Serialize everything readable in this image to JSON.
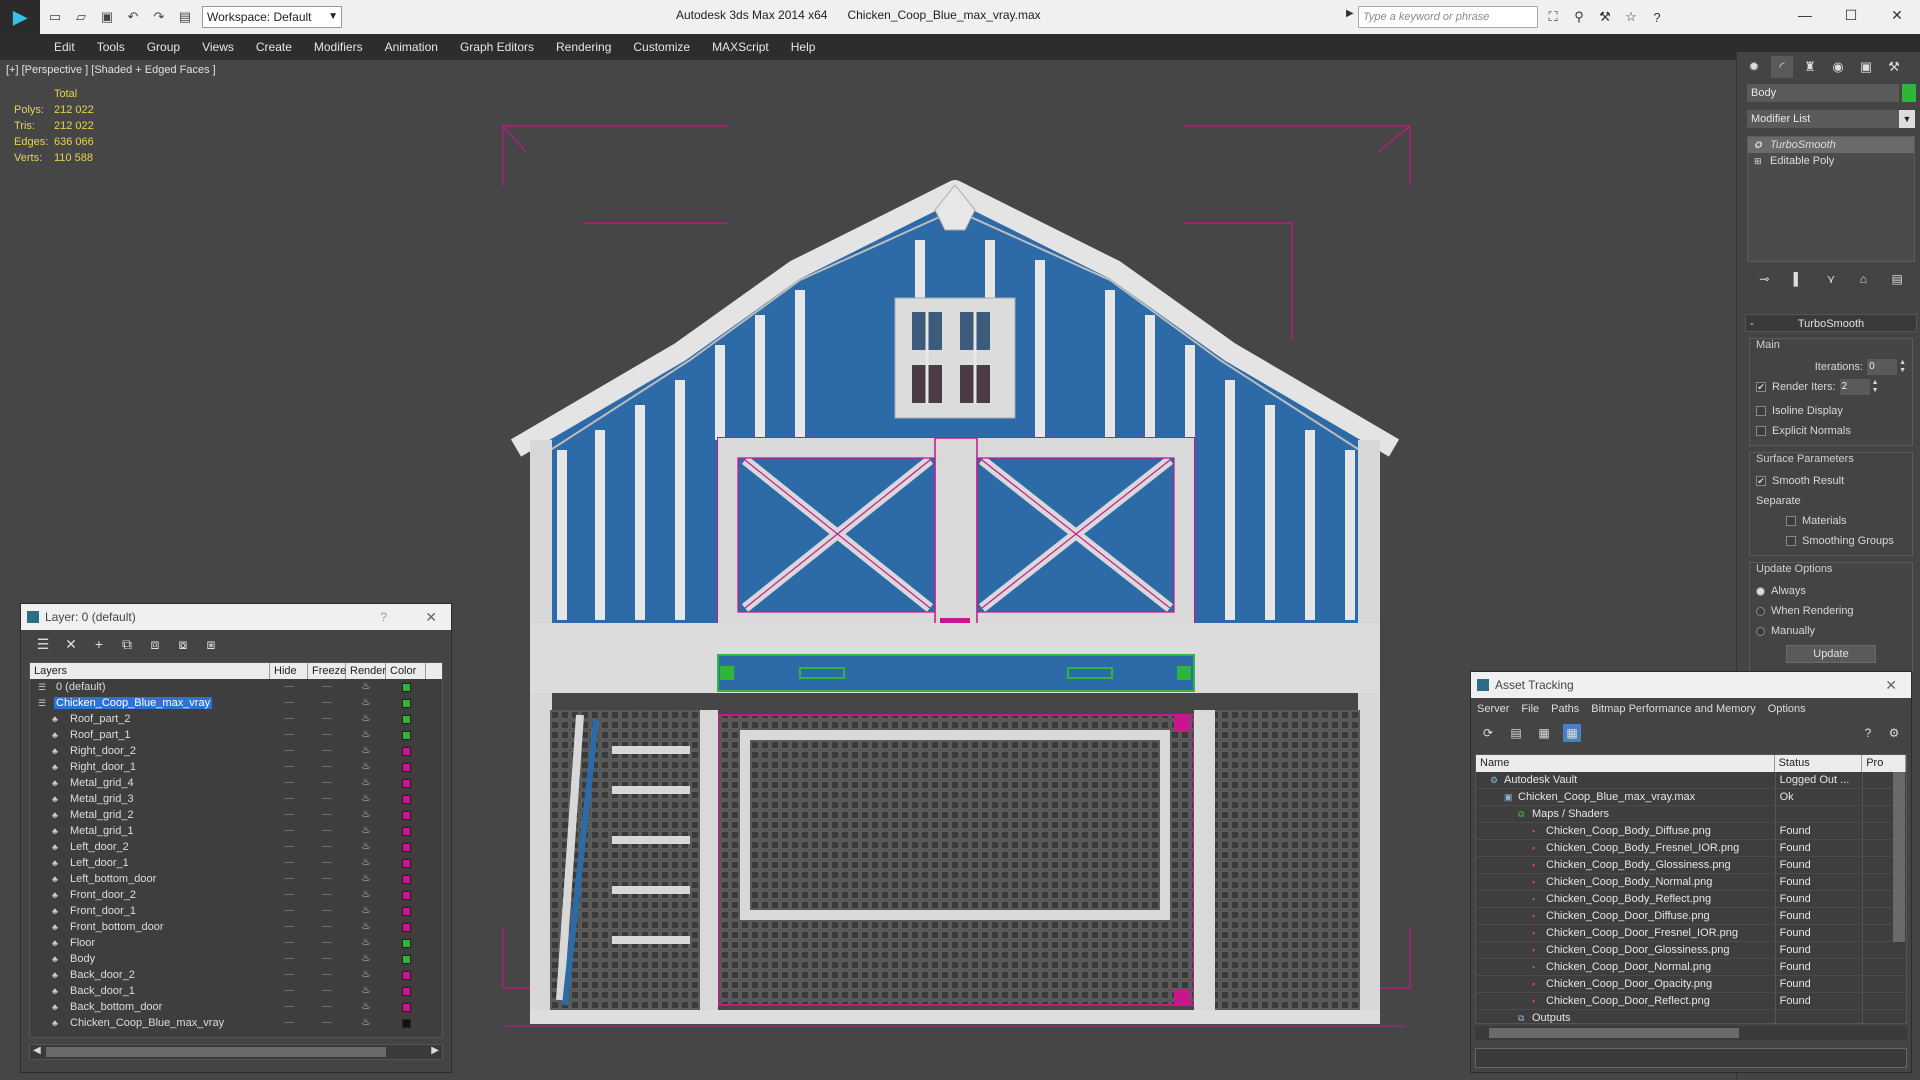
{
  "titlebar": {
    "app_title": "Autodesk 3ds Max 2014 x64",
    "file_name": "Chicken_Coop_Blue_max_vray.max",
    "workspace_label": "Workspace: Default",
    "search_placeholder": "Type a keyword or phrase"
  },
  "menu": [
    "Edit",
    "Tools",
    "Group",
    "Views",
    "Create",
    "Modifiers",
    "Animation",
    "Graph Editors",
    "Rendering",
    "Customize",
    "MAXScript",
    "Help"
  ],
  "viewport": {
    "label": "[+] [Perspective ] [Shaded + Edged Faces ]",
    "stats": {
      "header": "Total",
      "polys_label": "Polys:",
      "polys": "212 022",
      "tris_label": "Tris:",
      "tris": "212 022",
      "edges_label": "Edges:",
      "edges": "636 066",
      "verts_label": "Verts:",
      "verts": "110 588"
    }
  },
  "command_panel": {
    "object_name": "Body",
    "object_color": "#2fb63a",
    "modifier_list": "Modifier List",
    "stack": [
      "TurboSmooth",
      "Editable Poly"
    ],
    "rollout_title": "TurboSmooth",
    "main_group": "Main",
    "iterations_label": "Iterations:",
    "iterations_value": "0",
    "render_iters_label": "Render Iters:",
    "render_iters_value": "2",
    "isoline_label": "Isoline Display",
    "explicit_normals_label": "Explicit Normals",
    "surface_group": "Surface Parameters",
    "smooth_result_label": "Smooth Result",
    "separate_label": "Separate",
    "materials_label": "Materials",
    "smoothing_groups_label": "Smoothing Groups",
    "update_group": "Update Options",
    "always_label": "Always",
    "when_rendering_label": "When Rendering",
    "manually_label": "Manually",
    "update_button": "Update"
  },
  "layer_dialog": {
    "title": "Layer: 0 (default)",
    "help": "?",
    "columns": [
      "Layers",
      "Hide",
      "Freeze",
      "Render",
      "Color"
    ],
    "rows": [
      {
        "name": "0 (default)",
        "level": 0,
        "color": "#2fb63a",
        "check": "✔"
      },
      {
        "name": "Chicken_Coop_Blue_max_vray",
        "level": 0,
        "color": "#2fb63a",
        "selected": true
      },
      {
        "name": "Roof_part_2",
        "level": 1,
        "color": "#2fb63a"
      },
      {
        "name": "Roof_part_1",
        "level": 1,
        "color": "#2fb63a"
      },
      {
        "name": "Right_door_2",
        "level": 1,
        "color": "#c8168c"
      },
      {
        "name": "Right_door_1",
        "level": 1,
        "color": "#c8168c"
      },
      {
        "name": "Metal_grid_4",
        "level": 1,
        "color": "#c8168c"
      },
      {
        "name": "Metal_grid_3",
        "level": 1,
        "color": "#c8168c"
      },
      {
        "name": "Metal_grid_2",
        "level": 1,
        "color": "#c8168c"
      },
      {
        "name": "Metal_grid_1",
        "level": 1,
        "color": "#c8168c"
      },
      {
        "name": "Left_door_2",
        "level": 1,
        "color": "#c8168c"
      },
      {
        "name": "Left_door_1",
        "level": 1,
        "color": "#c8168c"
      },
      {
        "name": "Left_bottom_door",
        "level": 1,
        "color": "#c8168c"
      },
      {
        "name": "Front_door_2",
        "level": 1,
        "color": "#c8168c"
      },
      {
        "name": "Front_door_1",
        "level": 1,
        "color": "#c8168c"
      },
      {
        "name": "Front_bottom_door",
        "level": 1,
        "color": "#c8168c"
      },
      {
        "name": "Floor",
        "level": 1,
        "color": "#2fb63a"
      },
      {
        "name": "Body",
        "level": 1,
        "color": "#2fb63a"
      },
      {
        "name": "Back_door_2",
        "level": 1,
        "color": "#c8168c"
      },
      {
        "name": "Back_door_1",
        "level": 1,
        "color": "#c8168c"
      },
      {
        "name": "Back_bottom_door",
        "level": 1,
        "color": "#c8168c"
      },
      {
        "name": "Chicken_Coop_Blue_max_vray",
        "level": 1,
        "color": "#111111"
      }
    ]
  },
  "asset_dialog": {
    "title": "Asset Tracking",
    "menu": [
      "Server",
      "File",
      "Paths",
      "Bitmap Performance and Memory",
      "Options"
    ],
    "columns": [
      "Name",
      "Status",
      "Pro"
    ],
    "rows": [
      {
        "name": "Autodesk Vault",
        "level": 0,
        "status": "Logged Out ...",
        "icon": "vault"
      },
      {
        "name": "Chicken_Coop_Blue_max_vray.max",
        "level": 1,
        "status": "Ok",
        "icon": "max"
      },
      {
        "name": "Maps / Shaders",
        "level": 2,
        "status": "",
        "icon": "maps"
      },
      {
        "name": "Chicken_Coop_Body_Diffuse.png",
        "level": 3,
        "status": "Found",
        "icon": "png"
      },
      {
        "name": "Chicken_Coop_Body_Fresnel_IOR.png",
        "level": 3,
        "status": "Found",
        "icon": "png"
      },
      {
        "name": "Chicken_Coop_Body_Glossiness.png",
        "level": 3,
        "status": "Found",
        "icon": "png"
      },
      {
        "name": "Chicken_Coop_Body_Normal.png",
        "level": 3,
        "status": "Found",
        "icon": "png"
      },
      {
        "name": "Chicken_Coop_Body_Reflect.png",
        "level": 3,
        "status": "Found",
        "icon": "png"
      },
      {
        "name": "Chicken_Coop_Door_Diffuse.png",
        "level": 3,
        "status": "Found",
        "icon": "png"
      },
      {
        "name": "Chicken_Coop_Door_Fresnel_IOR.png",
        "level": 3,
        "status": "Found",
        "icon": "png"
      },
      {
        "name": "Chicken_Coop_Door_Glossiness.png",
        "level": 3,
        "status": "Found",
        "icon": "png"
      },
      {
        "name": "Chicken_Coop_Door_Normal.png",
        "level": 3,
        "status": "Found",
        "icon": "png"
      },
      {
        "name": "Chicken_Coop_Door_Opacity.png",
        "level": 3,
        "status": "Found",
        "icon": "png"
      },
      {
        "name": "Chicken_Coop_Door_Reflect.png",
        "level": 3,
        "status": "Found",
        "icon": "png"
      },
      {
        "name": "Outputs",
        "level": 2,
        "status": "",
        "icon": "out"
      }
    ]
  }
}
